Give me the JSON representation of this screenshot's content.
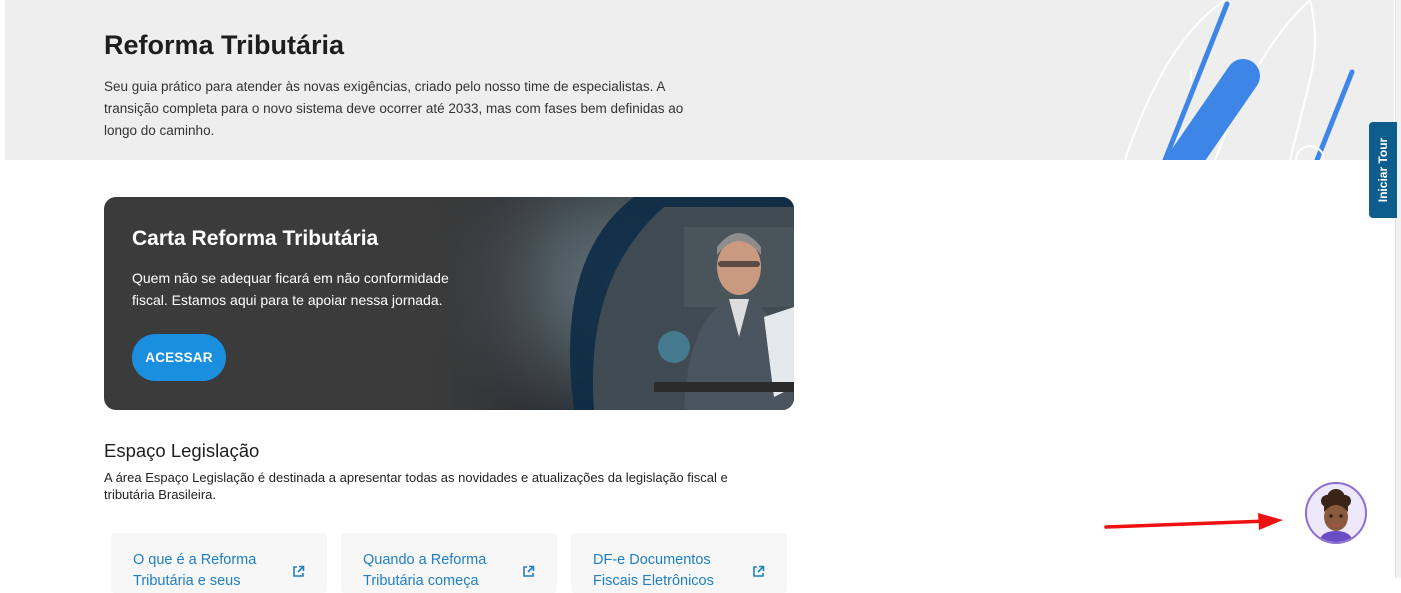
{
  "hero": {
    "title": "Reforma Tributária",
    "description": "Seu guia prático para atender às novas exigências, criado pelo nosso time de especialistas. A transição completa para o novo sistema deve ocorrer até 2033, mas com fases bem definidas ao longo do caminho."
  },
  "tour": {
    "label": "Iniciar Tour"
  },
  "promo": {
    "title": "Carta Reforma Tributária",
    "description": "Quem não se adequar ficará em não conformidade fiscal. Estamos aqui para te apoiar nessa jornada.",
    "button_label": "ACESSAR"
  },
  "legislacao": {
    "title": "Espaço Legislação",
    "description": "A área Espaço Legislação é destinada a apresentar todas as novidades e atualizações da legislação fiscal e tributária Brasileira.",
    "cards": [
      {
        "title": "O que é a Reforma Tributária e seus"
      },
      {
        "title": "Quando a Reforma Tributária começa"
      },
      {
        "title": "DF-e Documentos Fiscais Eletrônicos"
      }
    ]
  },
  "colors": {
    "accent": "#1a8fe0",
    "link": "#1f7fc4",
    "tour_tab": "#0d5e8c",
    "deco_blue": "#3d86e8",
    "annotation_arrow": "#ee1111"
  }
}
